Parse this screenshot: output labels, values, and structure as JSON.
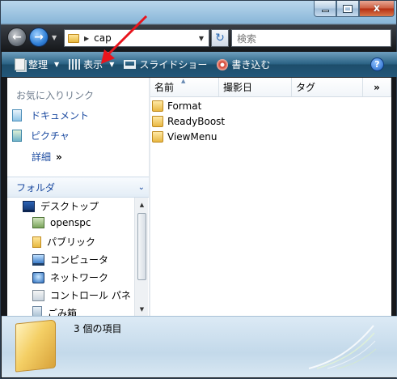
{
  "window": {
    "minimize_icon": "minimize-icon",
    "maximize_icon": "maximize-icon",
    "close_icon": "close-icon",
    "close_glyph": "x"
  },
  "address": {
    "path": "cap",
    "search_placeholder": "検索"
  },
  "toolbar": {
    "organize": "整理",
    "views": "表示",
    "slideshow": "スライドショー",
    "burn": "書き込む",
    "help": "?"
  },
  "nav": {
    "favorites_title": "お気に入りリンク",
    "favorites": [
      {
        "label": "ドキュメント",
        "icon": "documents-icon"
      },
      {
        "label": "ピクチャ",
        "icon": "pictures-icon"
      }
    ],
    "more": "詳細",
    "more_chevron": "»",
    "folders_title": "フォルダ",
    "tree": [
      {
        "label": "デスクトップ",
        "icon": "desktop-icon"
      },
      {
        "label": "openspc",
        "icon": "user-folder-icon"
      },
      {
        "label": "パブリック",
        "icon": "public-folder-icon"
      },
      {
        "label": "コンピュータ",
        "icon": "computer-icon"
      },
      {
        "label": "ネットワーク",
        "icon": "network-icon"
      },
      {
        "label": "コントロール パネ",
        "icon": "control-panel-icon"
      },
      {
        "label": "ごみ箱",
        "icon": "recycle-bin-icon"
      }
    ]
  },
  "list": {
    "columns": [
      "名前",
      "撮影日",
      "タグ",
      "»"
    ],
    "files": [
      "Format",
      "ReadyBoost",
      "ViewMenu"
    ]
  },
  "details": {
    "count_text": "3 個の項目"
  }
}
